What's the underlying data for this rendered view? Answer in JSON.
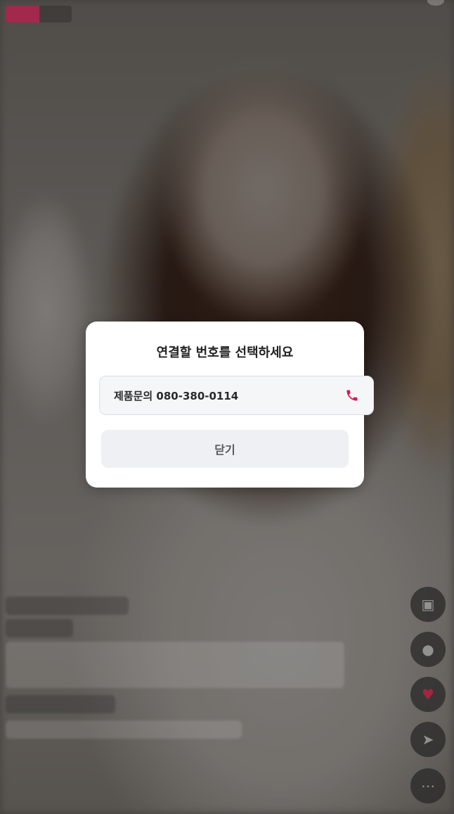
{
  "modal": {
    "title": "연결할 번호를 선택하세요",
    "options": [
      {
        "label": "제품문의 080-380-0114",
        "icon": "phone-icon"
      }
    ],
    "close_label": "닫기"
  },
  "colors": {
    "accent": "#e0164f",
    "modal_bg": "#ffffff",
    "option_bg": "#f5f6f8",
    "close_bg": "#eff0f3"
  },
  "side_actions": [
    "chat-icon",
    "comment-icon",
    "heart-icon",
    "share-icon",
    "more-icon"
  ]
}
